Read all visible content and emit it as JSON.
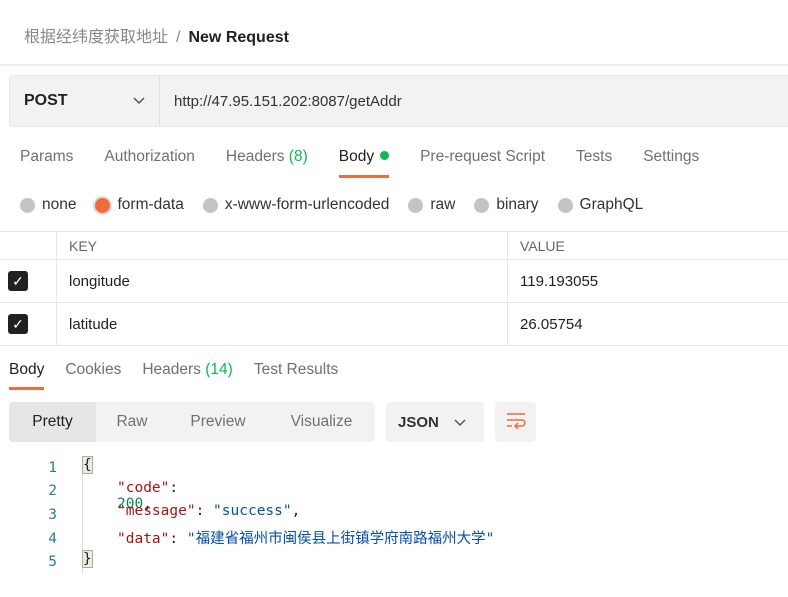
{
  "breadcrumb": {
    "parent": "根据经纬度获取地址",
    "separator": "/",
    "current": "New Request"
  },
  "request": {
    "method": "POST",
    "url": "http://47.95.151.202:8087/getAddr"
  },
  "request_tabs": [
    {
      "label": "Params"
    },
    {
      "label": "Authorization"
    },
    {
      "label": "Headers",
      "count": "(8)"
    },
    {
      "label": "Body",
      "active": true
    },
    {
      "label": "Pre-request Script"
    },
    {
      "label": "Tests"
    },
    {
      "label": "Settings"
    }
  ],
  "body_types": [
    {
      "label": "none"
    },
    {
      "label": "form-data",
      "selected": true
    },
    {
      "label": "x-www-form-urlencoded"
    },
    {
      "label": "raw"
    },
    {
      "label": "binary"
    },
    {
      "label": "GraphQL"
    }
  ],
  "table": {
    "headers": [
      "KEY",
      "VALUE"
    ],
    "rows": [
      {
        "checked": true,
        "key": "longitude",
        "value": "119.193055"
      },
      {
        "checked": true,
        "key": "latitude",
        "value": "26.05754"
      }
    ]
  },
  "response_tabs": [
    {
      "label": "Body",
      "active": true
    },
    {
      "label": "Cookies"
    },
    {
      "label": "Headers",
      "count": "(14)"
    },
    {
      "label": "Test Results"
    }
  ],
  "view_modes": [
    "Pretty",
    "Raw",
    "Preview",
    "Visualize"
  ],
  "format": "JSON",
  "colors": {
    "accent": "#f26b3a",
    "green": "#0cbb52"
  },
  "code": {
    "open": "{",
    "close": "}",
    "lines": [
      {
        "key": "\"code\"",
        "value": "200",
        "type": "n"
      },
      {
        "key": "\"message\"",
        "value": "\"success\"",
        "type": "s"
      },
      {
        "key": "\"data\"",
        "value": "\"福建省福州市闽侯县上街镇学府南路福州大学\"",
        "type": "s"
      }
    ],
    "numbers": [
      "1",
      "2",
      "3",
      "4",
      "5"
    ]
  }
}
